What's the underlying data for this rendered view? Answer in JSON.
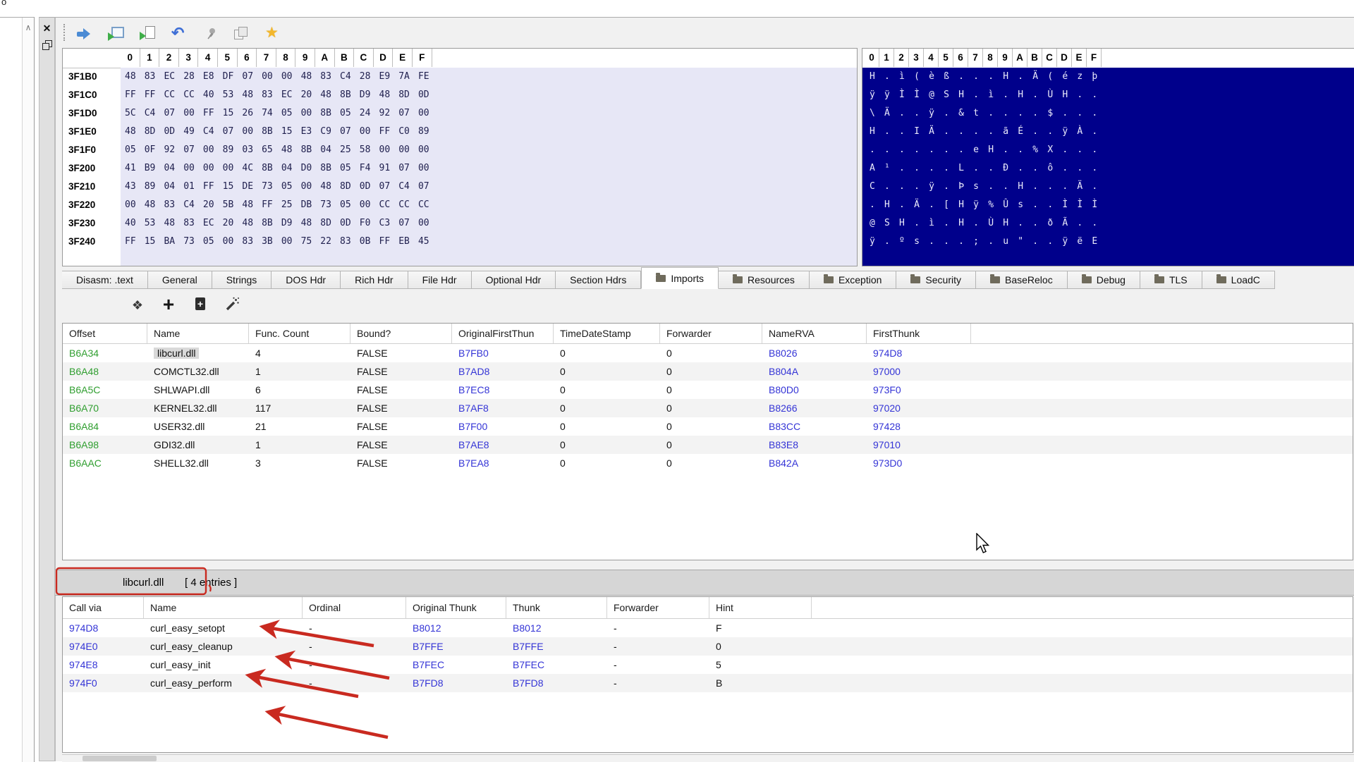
{
  "window": {
    "corner_text": "o"
  },
  "top_toolbar": {
    "icons": [
      "go-forward-icon",
      "load-window-icon",
      "import-file-icon",
      "undo-icon",
      "pin-icon",
      "compare-icon",
      "favorites-star-icon"
    ]
  },
  "hex_view": {
    "columns": [
      "0",
      "1",
      "2",
      "3",
      "4",
      "5",
      "6",
      "7",
      "8",
      "9",
      "A",
      "B",
      "C",
      "D",
      "E",
      "F"
    ],
    "rows": [
      {
        "addr": "3F1B0",
        "bytes": "48 83 EC 28 E8 DF 07 00 00 48 83 C4 28 E9 7A FE",
        "ascii": "H.ì(èß...H.Ä(ézþ"
      },
      {
        "addr": "3F1C0",
        "bytes": "FF FF CC CC 40 53 48 83 EC 20 48 8B D9 48 8D 0D",
        "ascii": "ÿÿÌÌ@SH.ì.H.ÙH.."
      },
      {
        "addr": "3F1D0",
        "bytes": "5C C4 07 00 FF 15 26 74 05 00 8B 05 24 92 07 00",
        "ascii": "\\Ä..ÿ.&t....$..."
      },
      {
        "addr": "3F1E0",
        "bytes": "48 8D 0D 49 C4 07 00 8B 15 E3 C9 07 00 FF C0 89",
        "ascii": "H..IÄ....ãÉ..ÿÀ."
      },
      {
        "addr": "3F1F0",
        "bytes": "05 0F 92 07 00 89 03 65 48 8B 04 25 58 00 00 00",
        "ascii": ".......eH..%X..."
      },
      {
        "addr": "3F200",
        "bytes": "41 B9 04 00 00 00 4C 8B 04 D0 8B 05 F4 91 07 00",
        "ascii": "A¹....L..Ð..ô..."
      },
      {
        "addr": "3F210",
        "bytes": "43 89 04 01 FF 15 DE 73 05 00 48 8D 0D 07 C4 07",
        "ascii": "C...ÿ.Þs..H...Ä."
      },
      {
        "addr": "3F220",
        "bytes": "00 48 83 C4 20 5B 48 FF 25 DB 73 05 00 CC CC CC",
        "ascii": ".H.Ä.[Hÿ%Ûs..ÌÌÌ"
      },
      {
        "addr": "3F230",
        "bytes": "40 53 48 83 EC 20 48 8B D9 48 8D 0D F0 C3 07 00",
        "ascii": "@SH.ì.H.ÙH..ðÃ.."
      },
      {
        "addr": "3F240",
        "bytes": "FF 15 BA 73 05 00 83 3B 00 75 22 83 0B FF EB 45",
        "ascii": "ÿ.ºs...;.u\"..ÿëE"
      }
    ]
  },
  "tabs": [
    {
      "label": "Disasm: .text"
    },
    {
      "label": "General"
    },
    {
      "label": "Strings"
    },
    {
      "label": "DOS Hdr"
    },
    {
      "label": "Rich Hdr"
    },
    {
      "label": "File Hdr"
    },
    {
      "label": "Optional Hdr"
    },
    {
      "label": "Section Hdrs"
    },
    {
      "label": "Imports",
      "folder": true,
      "active": true
    },
    {
      "label": "Resources",
      "folder": true
    },
    {
      "label": "Exception",
      "folder": true
    },
    {
      "label": "Security",
      "folder": true
    },
    {
      "label": "BaseReloc",
      "folder": true
    },
    {
      "label": "Debug",
      "folder": true
    },
    {
      "label": "TLS",
      "folder": true
    },
    {
      "label": "LoadC",
      "folder": true
    }
  ],
  "imports_toolbar": {
    "icons": [
      "move-cross-icon",
      "add-entry-icon",
      "add-import-doc-icon",
      "magic-wand-icon"
    ]
  },
  "imports_table": {
    "columns": {
      "offset": "Offset",
      "name": "Name",
      "func": "Func. Count",
      "bound": "Bound?",
      "oft": "OriginalFirstThun",
      "tds": "TimeDateStamp",
      "fwd": "Forwarder",
      "namerva": "NameRVA",
      "ft": "FirstThunk"
    },
    "rows": [
      {
        "offset": "B6A34",
        "name": "libcurl.dll",
        "func": "4",
        "bound": "FALSE",
        "oft": "B7FB0",
        "tds": "0",
        "fwd": "0",
        "namerva": "B8026",
        "ft": "974D8",
        "sel": true
      },
      {
        "offset": "B6A48",
        "name": "COMCTL32.dll",
        "func": "1",
        "bound": "FALSE",
        "oft": "B7AD8",
        "tds": "0",
        "fwd": "0",
        "namerva": "B804A",
        "ft": "97000"
      },
      {
        "offset": "B6A5C",
        "name": "SHLWAPI.dll",
        "func": "6",
        "bound": "FALSE",
        "oft": "B7EC8",
        "tds": "0",
        "fwd": "0",
        "namerva": "B80D0",
        "ft": "973F0"
      },
      {
        "offset": "B6A70",
        "name": "KERNEL32.dll",
        "func": "117",
        "bound": "FALSE",
        "oft": "B7AF8",
        "tds": "0",
        "fwd": "0",
        "namerva": "B8266",
        "ft": "97020"
      },
      {
        "offset": "B6A84",
        "name": "USER32.dll",
        "func": "21",
        "bound": "FALSE",
        "oft": "B7F00",
        "tds": "0",
        "fwd": "0",
        "namerva": "B83CC",
        "ft": "97428"
      },
      {
        "offset": "B6A98",
        "name": "GDI32.dll",
        "func": "1",
        "bound": "FALSE",
        "oft": "B7AE8",
        "tds": "0",
        "fwd": "0",
        "namerva": "B83E8",
        "ft": "97010"
      },
      {
        "offset": "B6AAC",
        "name": "SHELL32.dll",
        "func": "3",
        "bound": "FALSE",
        "oft": "B7EA8",
        "tds": "0",
        "fwd": "0",
        "namerva": "B842A",
        "ft": "973D0"
      }
    ]
  },
  "detail": {
    "title": "libcurl.dll",
    "entries_label": "[ 4 entries ]",
    "columns": {
      "callvia": "Call via",
      "name": "Name",
      "ordinal": "Ordinal",
      "othunk": "Original Thunk",
      "thunk": "Thunk",
      "fwd": "Forwarder",
      "hint": "Hint"
    },
    "rows": [
      {
        "callvia": "974D8",
        "name": "curl_easy_setopt",
        "ordinal": "-",
        "othunk": "B8012",
        "thunk": "B8012",
        "fwd": "-",
        "hint": "F"
      },
      {
        "callvia": "974E0",
        "name": "curl_easy_cleanup",
        "ordinal": "-",
        "othunk": "B7FFE",
        "thunk": "B7FFE",
        "fwd": "-",
        "hint": "0"
      },
      {
        "callvia": "974E8",
        "name": "curl_easy_init",
        "ordinal": "-",
        "othunk": "B7FEC",
        "thunk": "B7FEC",
        "fwd": "-",
        "hint": "5"
      },
      {
        "callvia": "974F0",
        "name": "curl_easy_perform",
        "ordinal": "-",
        "othunk": "B7FD8",
        "thunk": "B7FD8",
        "fwd": "-",
        "hint": "B"
      }
    ]
  },
  "colors": {
    "offset_green": "#2f9e2f",
    "link_blue": "#3434d6",
    "annotation_red": "#c92a20",
    "ascii_bg": "#00008b",
    "hex_bg": "#e7e7f6"
  }
}
